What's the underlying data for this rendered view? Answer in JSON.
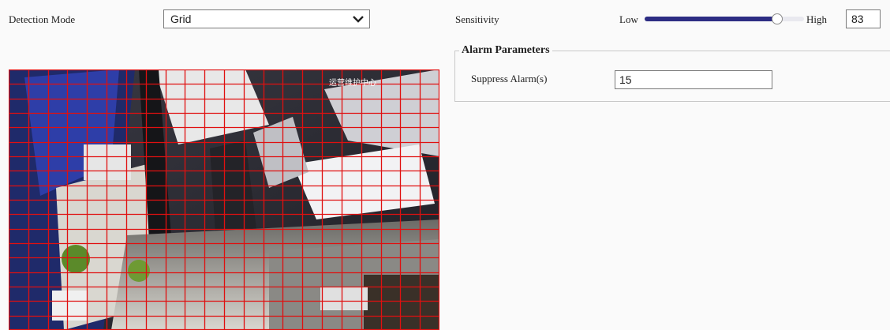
{
  "detection": {
    "label": "Detection Mode",
    "selected": "Grid"
  },
  "sensitivity": {
    "label": "Sensitivity",
    "low_label": "Low",
    "high_label": "High",
    "value": "83",
    "level_percent": 83
  },
  "alarm": {
    "legend": "Alarm Parameters",
    "suppress_label": "Suppress Alarm(s)",
    "suppress_value": "15"
  },
  "video": {
    "osd_text": "运营维护中心"
  },
  "grid": {
    "columns": 22,
    "rows": 18,
    "color": "#e01010"
  },
  "colors": {
    "slider_fill": "#2d2d83",
    "page_bg": "#fafafa"
  }
}
